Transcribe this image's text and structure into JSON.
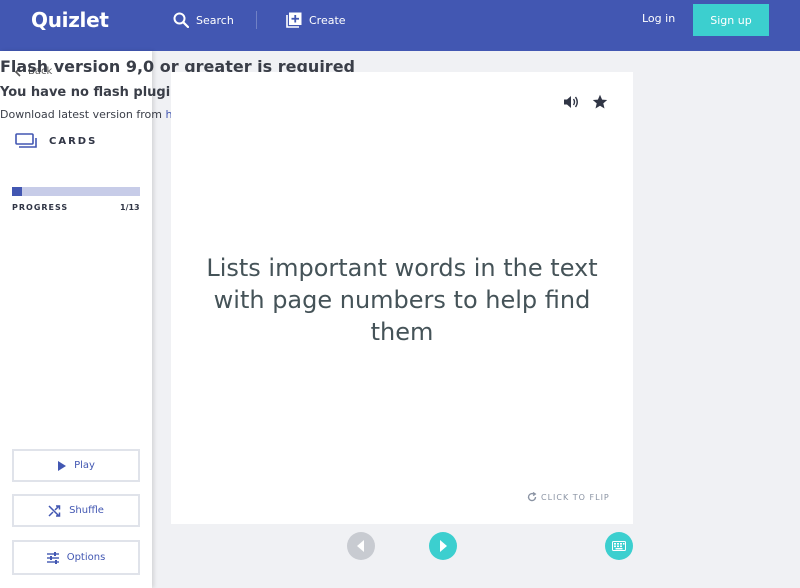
{
  "header": {
    "logo": "Quizlet",
    "search_label": "Search",
    "create_label": "Create",
    "login_label": "Log in",
    "signup_label": "Sign up"
  },
  "flash_notice": {
    "title": "Flash version 9,0 or greater is required",
    "subtitle": "You have no flash plugin installed",
    "download_prefix": "Download latest version from ",
    "download_link": "here"
  },
  "sidebar": {
    "back_label": "Back",
    "mode_label": "CARDS",
    "progress_label": "PROGRESS",
    "progress_count": "1/13",
    "progress_current": 1,
    "progress_total": 13,
    "play_label": "Play",
    "shuffle_label": "Shuffle",
    "options_label": "Options"
  },
  "card": {
    "text": "Lists important words in the text with page numbers to help find them",
    "flip_label": "CLICK TO FLIP"
  },
  "icons": {
    "search": "search-icon",
    "create": "create-icon",
    "back": "chevron-left-icon",
    "cards": "cards-icon",
    "play": "play-icon",
    "shuffle": "shuffle-icon",
    "options": "sliders-icon",
    "audio": "speaker-icon",
    "star": "star-icon",
    "flip": "refresh-icon",
    "prev": "arrow-left-icon",
    "next": "arrow-right-icon",
    "keyboard": "keyboard-icon"
  },
  "colors": {
    "brand": "#4257b2",
    "accent": "#3ccfcf",
    "background": "#f0f1f4",
    "progress_track": "#c7cce8"
  }
}
